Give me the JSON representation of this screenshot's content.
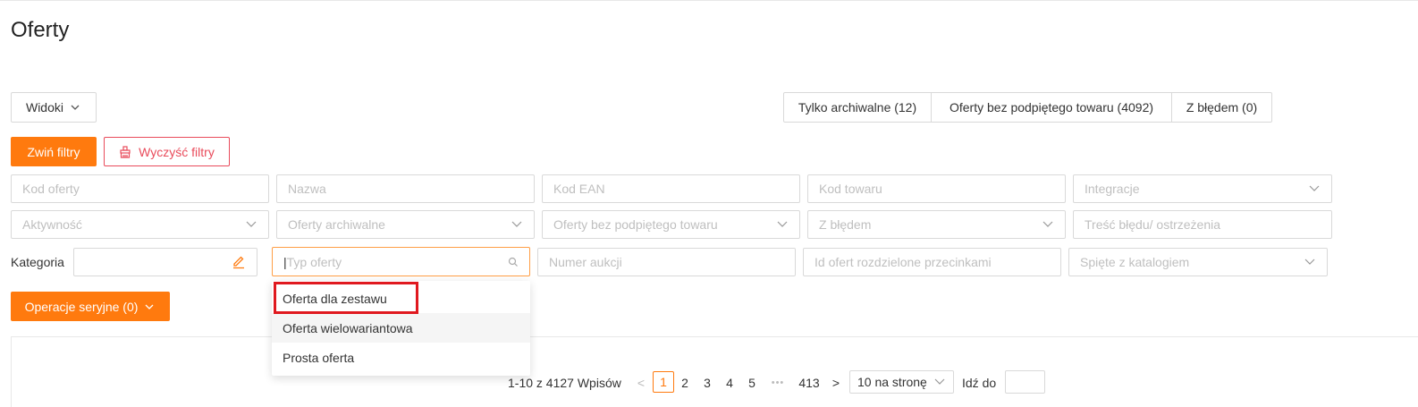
{
  "page": {
    "title": "Oferty"
  },
  "views": {
    "label": "Widoki"
  },
  "quick_filters": [
    {
      "label": "Tylko archiwalne (12)"
    },
    {
      "label": "Oferty bez podpiętego towaru (4092)"
    },
    {
      "label": "Z błędem (0)"
    }
  ],
  "actions": {
    "collapse_filters": "Zwiń filtry",
    "clear_filters": "Wyczyść filtry",
    "bulk_operations": "Operacje seryjne (0)"
  },
  "filters": {
    "offer_code": "Kod oferty",
    "name": "Nazwa",
    "ean": "Kod EAN",
    "product_code": "Kod towaru",
    "integrations": "Integracje",
    "activity": "Aktywność",
    "archived": "Oferty archiwalne",
    "unlinked": "Oferty bez podpiętego towaru",
    "with_error": "Z błędem",
    "error_text": "Treść błędu/ ostrzeżenia",
    "category_label": "Kategoria",
    "offer_type": "Typ oferty",
    "auction_number": "Numer aukcji",
    "offer_ids": "Id ofert rozdzielone przecinkami",
    "catalog_linked": "Spięte z katalogiem"
  },
  "offer_type_dropdown": {
    "options": [
      "Oferta dla zestawu",
      "Oferta wielowariantowa",
      "Prosta oferta"
    ]
  },
  "pagination": {
    "summary": "1-10 z 4127 Wpisów",
    "prev": "<",
    "next": ">",
    "pages": [
      "1",
      "2",
      "3",
      "4",
      "5"
    ],
    "ellipsis": "•••",
    "last": "413",
    "current": "1",
    "page_size": "10 na stronę",
    "goto_label": "Idź do"
  },
  "colors": {
    "accent": "#ff7a0e",
    "danger": "#e94b5b",
    "highlight": "#e0191f"
  }
}
